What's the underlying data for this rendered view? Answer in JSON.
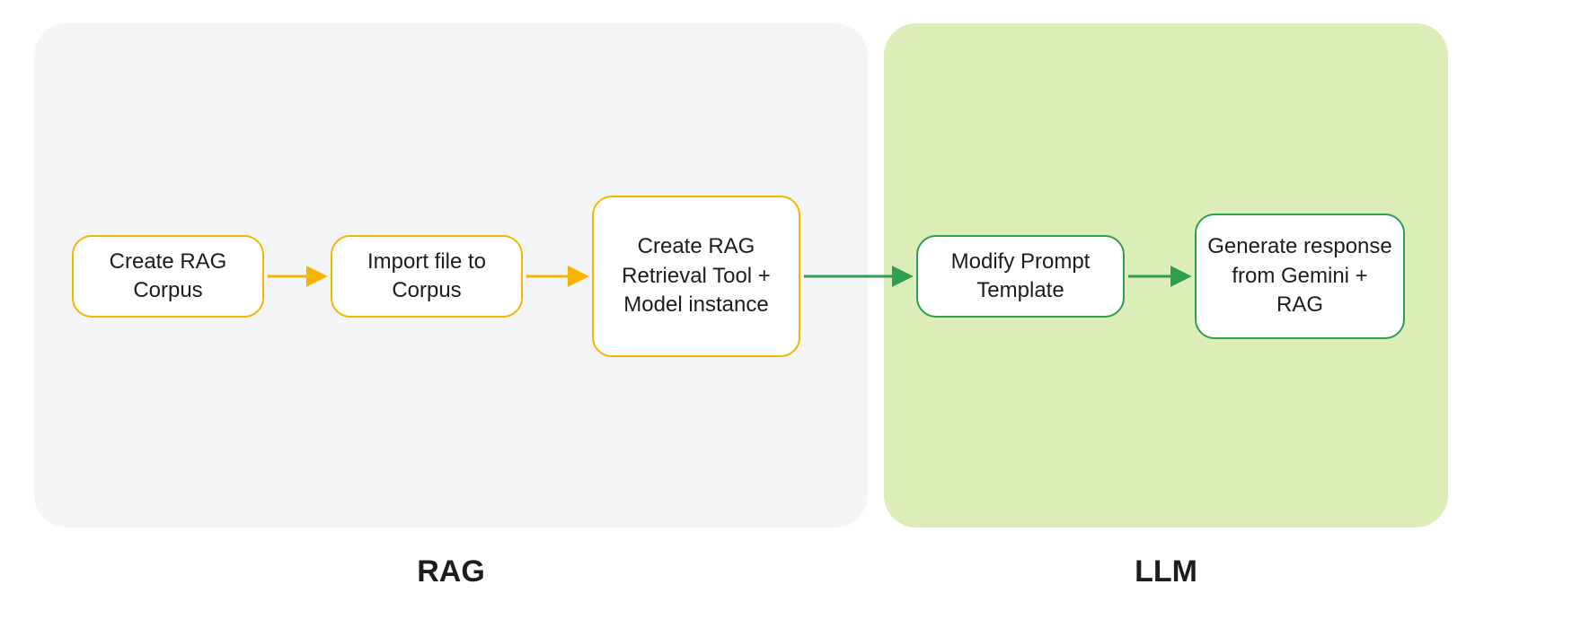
{
  "sections": {
    "rag": {
      "label": "RAG"
    },
    "llm": {
      "label": "LLM"
    }
  },
  "nodes": {
    "n1": "Create RAG Corpus",
    "n2": "Import file to Corpus",
    "n3": "Create RAG Retrieval Tool + Model instance",
    "n4": "Modify Prompt Template",
    "n5": "Generate response from Gemini + RAG"
  },
  "colors": {
    "orange": "#f7b400",
    "green": "#2e9e51",
    "rag_bg": "#f3f5f7",
    "llm_bg": "#dcedb7"
  },
  "edges": [
    {
      "from": "n1",
      "to": "n2",
      "color": "orange"
    },
    {
      "from": "n2",
      "to": "n3",
      "color": "orange"
    },
    {
      "from": "n3",
      "to": "n4",
      "color": "green"
    },
    {
      "from": "n4",
      "to": "n5",
      "color": "green"
    }
  ]
}
